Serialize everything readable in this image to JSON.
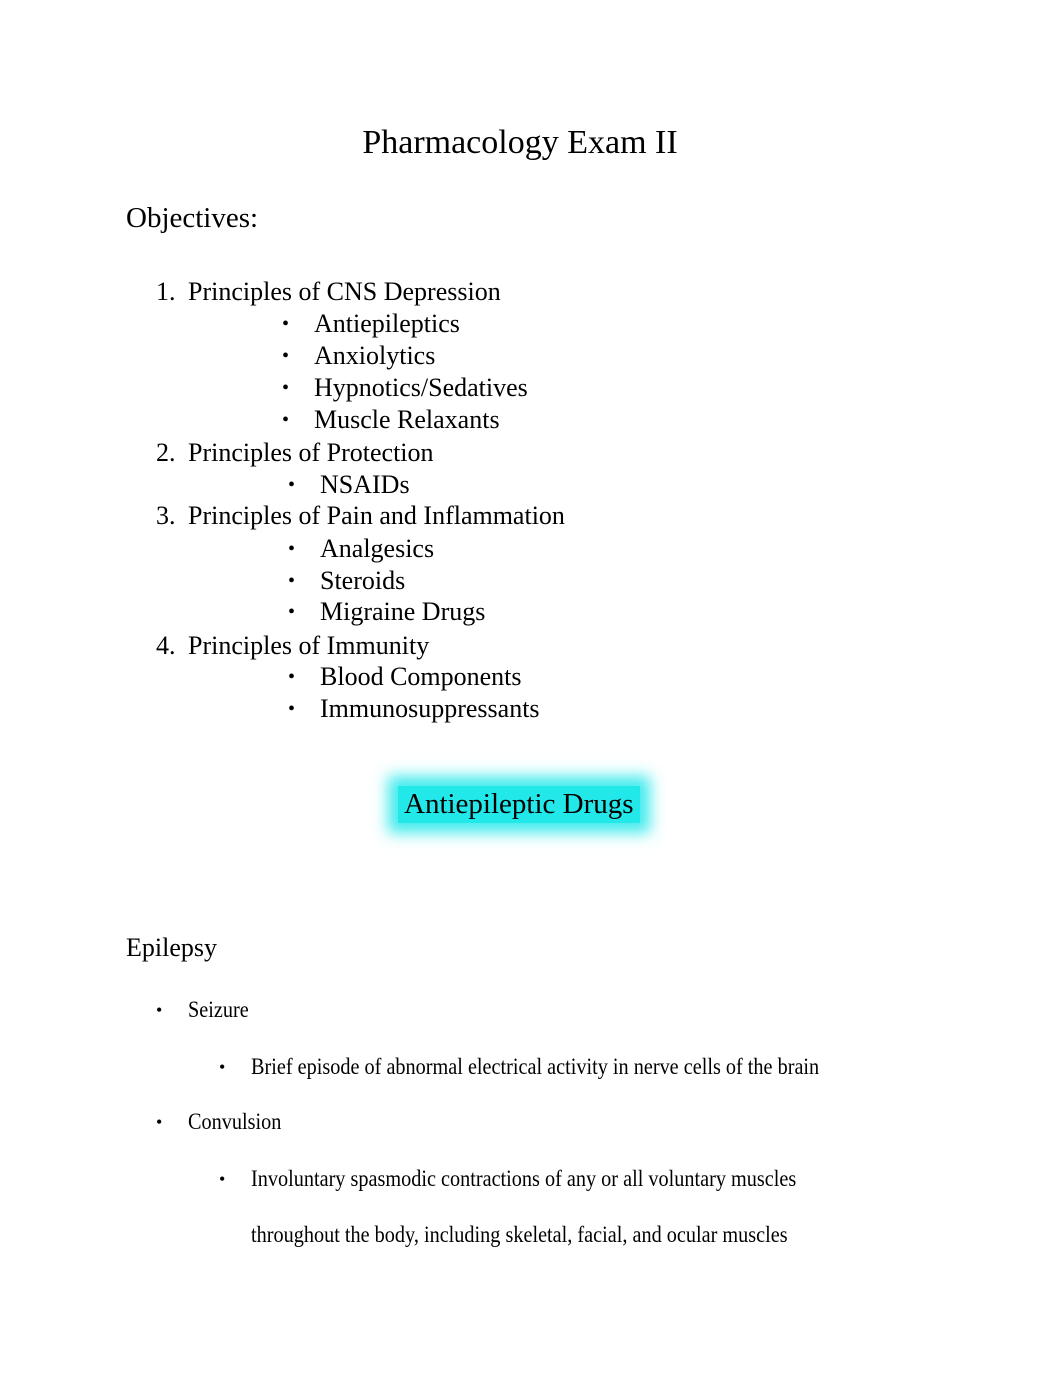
{
  "document": {
    "title": "Pharmacology Exam II",
    "objectives_heading": "Objectives:",
    "objectives": [
      {
        "number": "1.",
        "label": "Principles of CNS Depression",
        "items": [
          "Antiepileptics",
          "Anxiolytics",
          "Hypnotics/Sedatives",
          "Muscle Relaxants"
        ]
      },
      {
        "number": "2.",
        "label": "Principles of Protection",
        "items": [
          "NSAIDs"
        ]
      },
      {
        "number": "3.",
        "label": "Principles of Pain and Inflammation",
        "items": [
          "Analgesics",
          "Steroids",
          "Migraine Drugs"
        ]
      },
      {
        "number": "4.",
        "label": "Principles of Immunity",
        "items": [
          "Blood Components",
          "Immunosuppressants"
        ]
      }
    ],
    "section_title": "Antiepileptic Drugs",
    "section_highlight_color": "#22e8ea",
    "subsection_heading": "Epilepsy",
    "terms": [
      {
        "term": "Seizure",
        "definition_lines": [
          "Brief episode of abnormal electrical activity in nerve cells of the brain"
        ]
      },
      {
        "term": "Convulsion",
        "definition_lines": [
          "Involuntary spasmodic contractions of any or all voluntary muscles",
          "throughout the body, including skeletal, facial, and ocular muscles"
        ]
      }
    ],
    "bullet_glyph": "•"
  }
}
